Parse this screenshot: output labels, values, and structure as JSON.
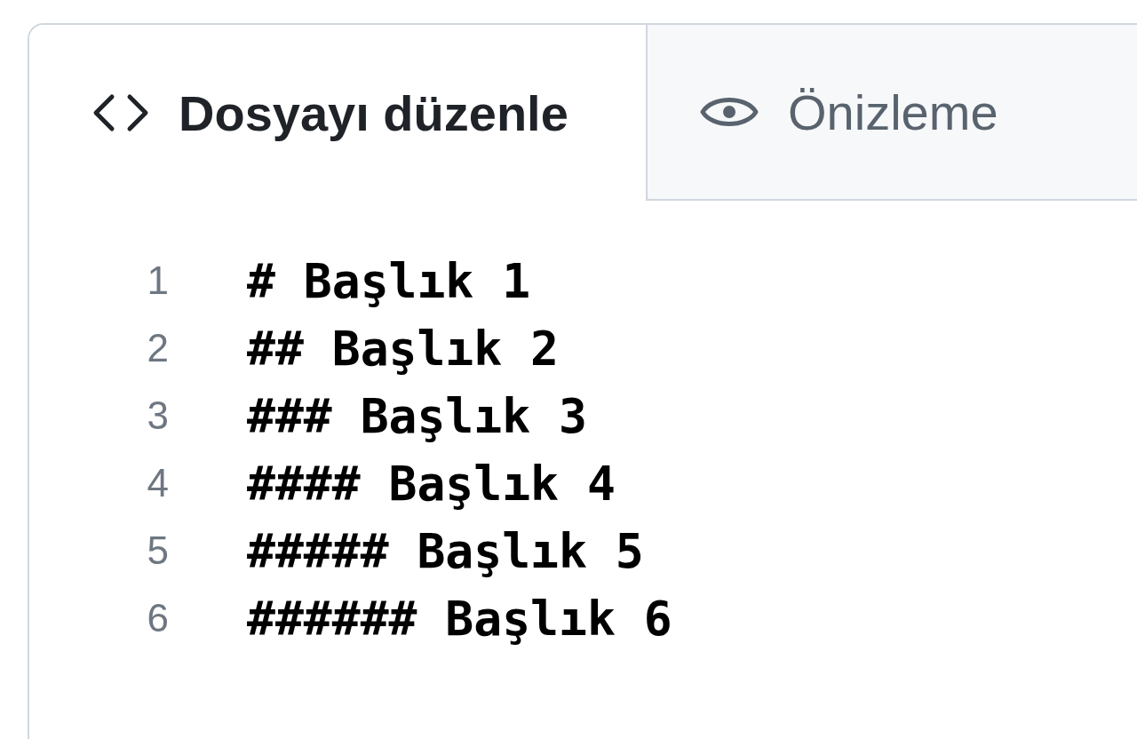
{
  "tabs": [
    {
      "label": "Dosyayı düzenle",
      "kind": "code",
      "selected": true
    },
    {
      "label": "Önizleme",
      "kind": "eye",
      "selected": false
    }
  ],
  "lines": [
    {
      "number": "1",
      "text": "# Başlık 1"
    },
    {
      "number": "2",
      "text": "## Başlık 2"
    },
    {
      "number": "3",
      "text": "### Başlık 3"
    },
    {
      "number": "4",
      "text": "#### Başlık 4"
    },
    {
      "number": "5",
      "text": "##### Başlık 5"
    },
    {
      "number": "6",
      "text": "###### Başlık 6"
    }
  ]
}
